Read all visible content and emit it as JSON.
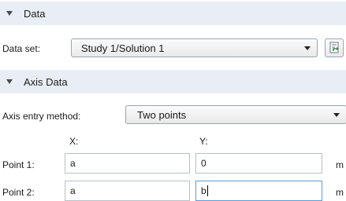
{
  "data_section": {
    "title": "Data",
    "data_set_label": "Data set:",
    "data_set_value": "Study 1/Solution 1"
  },
  "axis_section": {
    "title": "Axis Data",
    "entry_method_label": "Axis entry method:",
    "entry_method_value": "Two points",
    "col_x": "X:",
    "col_y": "Y:",
    "point1_label": "Point 1:",
    "point1_x": "a",
    "point1_y": "0",
    "point1_unit": "m",
    "point2_label": "Point 2:",
    "point2_x": "a",
    "point2_y": "b",
    "point2_unit": "m"
  },
  "icons": {
    "section_toggle": "triangle-down-icon",
    "dropdown": "chevron-down-icon",
    "goto_source": "goto-source-icon"
  },
  "colors": {
    "section_header_bg": "#e9eef4",
    "focus_border": "#5a9bd8"
  }
}
